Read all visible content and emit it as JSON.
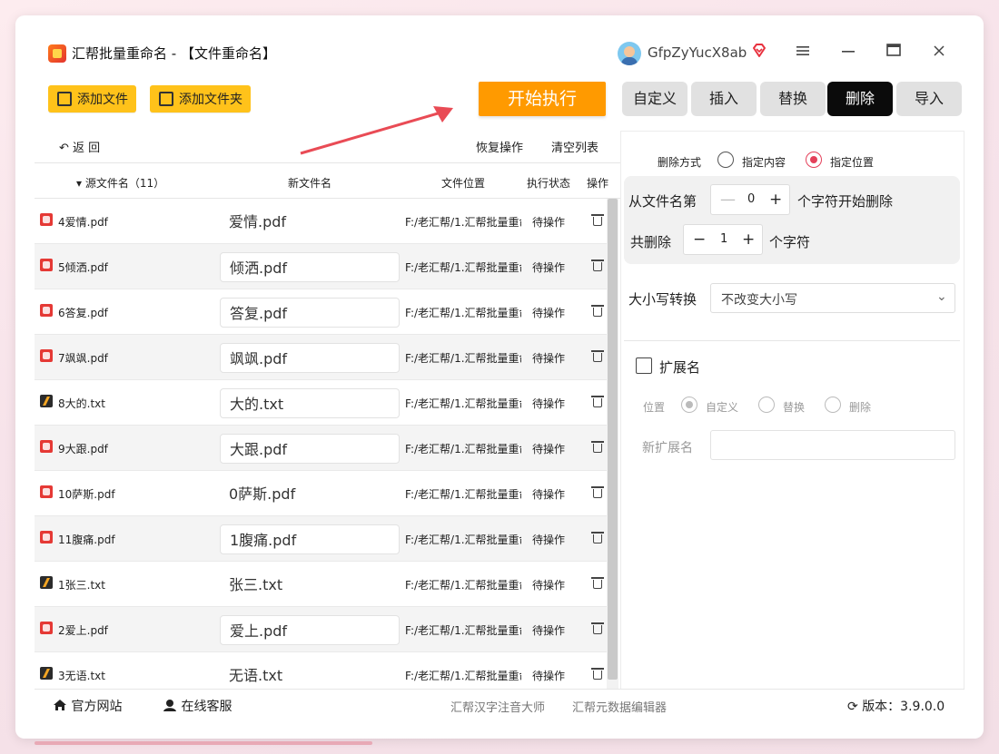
{
  "app": {
    "title": "汇帮批量重命名 - 【文件重命名】",
    "username": "GfpZyYucX8ab"
  },
  "toolbar": {
    "add_file": "添加文件",
    "add_folder": "添加文件夹",
    "start": "开始执行",
    "tabs": [
      "自定义",
      "插入",
      "替换",
      "删除",
      "导入"
    ],
    "active_tab": "删除"
  },
  "list": {
    "undo": "返 回",
    "restore": "恢复操作",
    "clear": "清空列表",
    "headers": {
      "src": "源文件名（11）",
      "new": "新文件名",
      "path": "文件位置",
      "status": "执行状态",
      "op": "操作"
    },
    "rows": [
      {
        "type": "pdf",
        "src": "4爱情.pdf",
        "new": "爱情.pdf",
        "path": "F:/老汇帮/1.汇帮批量重命名",
        "status": "待操作"
      },
      {
        "type": "pdf",
        "src": "5倾洒.pdf",
        "new": "倾洒.pdf",
        "path": "F:/老汇帮/1.汇帮批量重命名",
        "status": "待操作"
      },
      {
        "type": "pdf",
        "src": "6答复.pdf",
        "new": "答复.pdf",
        "path": "F:/老汇帮/1.汇帮批量重命名",
        "status": "待操作"
      },
      {
        "type": "pdf",
        "src": "7飒飒.pdf",
        "new": "飒飒.pdf",
        "path": "F:/老汇帮/1.汇帮批量重命名",
        "status": "待操作"
      },
      {
        "type": "txt",
        "src": "8大的.txt",
        "new": "大的.txt",
        "path": "F:/老汇帮/1.汇帮批量重命名",
        "status": "待操作"
      },
      {
        "type": "pdf",
        "src": "9大跟.pdf",
        "new": "大跟.pdf",
        "path": "F:/老汇帮/1.汇帮批量重命名",
        "status": "待操作"
      },
      {
        "type": "pdf",
        "src": "10萨斯.pdf",
        "new": "0萨斯.pdf",
        "path": "F:/老汇帮/1.汇帮批量重命名",
        "status": "待操作"
      },
      {
        "type": "pdf",
        "src": "11腹痛.pdf",
        "new": "1腹痛.pdf",
        "path": "F:/老汇帮/1.汇帮批量重命名",
        "status": "待操作"
      },
      {
        "type": "txt",
        "src": "1张三.txt",
        "new": "张三.txt",
        "path": "F:/老汇帮/1.汇帮批量重命名",
        "status": "待操作"
      },
      {
        "type": "pdf",
        "src": "2爱上.pdf",
        "new": "爱上.pdf",
        "path": "F:/老汇帮/1.汇帮批量重命名",
        "status": "待操作"
      },
      {
        "type": "txt",
        "src": "3无语.txt",
        "new": "无语.txt",
        "path": "F:/老汇帮/1.汇帮批量重命名",
        "status": "待操作"
      }
    ]
  },
  "panel": {
    "delete_mode_label": "删除方式",
    "mode_content": "指定内容",
    "mode_position": "指定位置",
    "from_label": "从文件名第",
    "from_value": "0",
    "from_suffix": "个字符开始删除",
    "count_label": "共删除",
    "count_value": "1",
    "count_suffix": "个字符",
    "case_label": "大小写转换",
    "case_value": "不改变大小写",
    "ext_label": "扩展名",
    "pos_label": "位置",
    "ext_custom": "自定义",
    "ext_replace": "替换",
    "ext_delete": "删除",
    "new_ext_label": "新扩展名"
  },
  "footer": {
    "website": "官方网站",
    "service": "在线客服",
    "link1": "汇帮汉字注音大师",
    "link2": "汇帮元数据编辑器",
    "version": "版本：3.9.0.0"
  }
}
